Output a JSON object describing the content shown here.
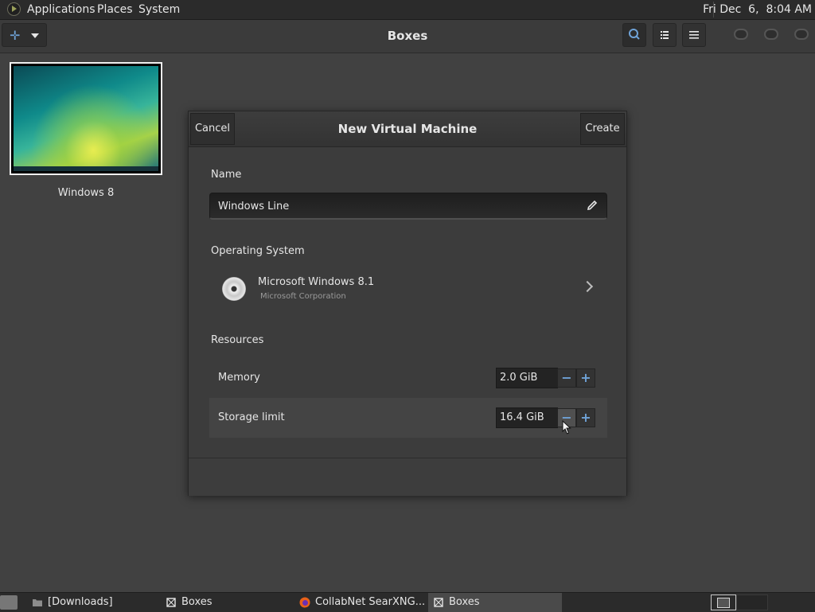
{
  "top_panel": {
    "menus": [
      "Applications",
      "Places",
      "System"
    ],
    "clock": "Fri Dec  6,  8:04 AM"
  },
  "headerbar": {
    "title": "Boxes",
    "new_button_icon": "plus-icon",
    "right_buttons": [
      "search-icon",
      "list-view-icon",
      "menu-icon"
    ]
  },
  "boxes": [
    {
      "label": "Windows 8"
    }
  ],
  "dialog": {
    "cancel_label": "Cancel",
    "title": "New Virtual Machine",
    "create_label": "Create",
    "name_section": "Name",
    "name_value": "Windows Line",
    "os_section": "Operating System",
    "os_name": "Microsoft Windows 8.1",
    "os_vendor": "Microsoft Corporation",
    "resources_section": "Resources",
    "memory_label": "Memory",
    "memory_value": "2.0 GiB",
    "storage_label": "Storage limit",
    "storage_value": "16.4 GiB",
    "minus_glyph": "−",
    "plus_glyph": "+"
  },
  "taskbar": {
    "items": [
      "[Downloads]",
      "Boxes",
      "CollabNet SearXNG...",
      "Boxes"
    ]
  },
  "colors": {
    "accent": "#6fa3d8",
    "background": "#414141"
  }
}
